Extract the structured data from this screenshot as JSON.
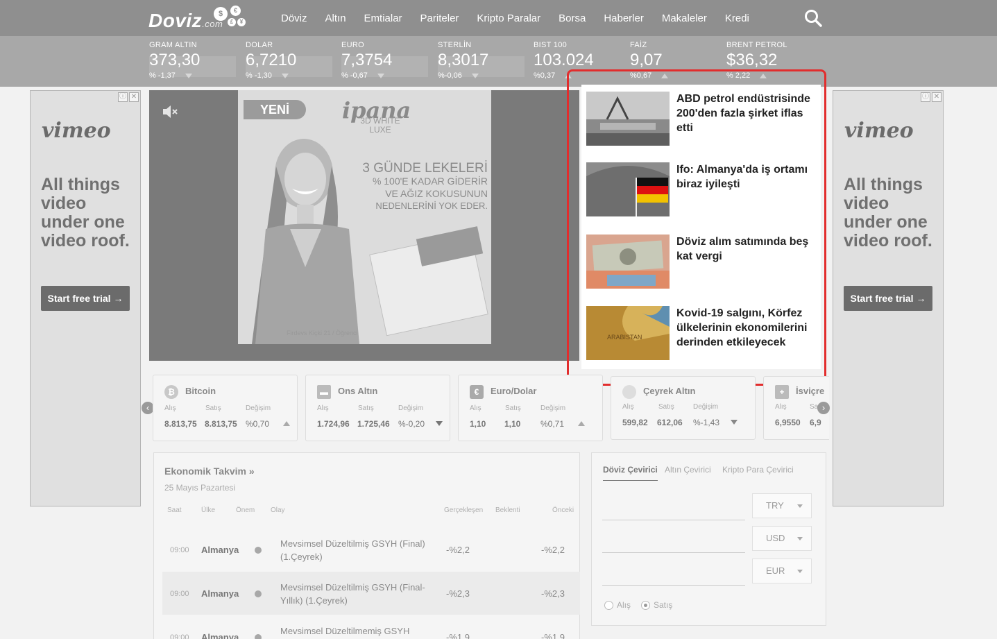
{
  "logo": {
    "text": "Doviz",
    "suffix": ".com",
    "coins": [
      "$",
      "€",
      "£",
      "¥"
    ]
  },
  "nav": [
    "Döviz",
    "Altın",
    "Emtialar",
    "Pariteler",
    "Kripto Paralar",
    "Borsa",
    "Haberler",
    "Makaleler",
    "Kredi"
  ],
  "ticker": [
    {
      "name": "GRAM ALTIN",
      "value": "373,30",
      "change": "% -1,37",
      "dir": "down"
    },
    {
      "name": "DOLAR",
      "value": "6,7210",
      "change": "% -1,30",
      "dir": "down"
    },
    {
      "name": "EURO",
      "value": "7,3754",
      "change": "% -0,67",
      "dir": "down"
    },
    {
      "name": "STERLİN",
      "value": "8,3017",
      "change": "%-0,06",
      "dir": "down"
    },
    {
      "name": "BIST 100",
      "value": "103.024",
      "change": "%0,37",
      "dir": "up"
    },
    {
      "name": "FAİZ",
      "value": "9,07",
      "change": "%0,67",
      "dir": "up"
    },
    {
      "name": "BRENT PETROL",
      "value": "$36,32",
      "change": "% 2,22",
      "dir": "up"
    }
  ],
  "side_ad": {
    "brand": "vimeo",
    "tagline": "All things video under one video roof.",
    "cta": "Start free trial →",
    "info": "ⓘ",
    "close": "✕"
  },
  "video_ad": {
    "badge": "YENİ",
    "logo": "ipana",
    "sub": "3D WHITE LUXE",
    "line1": "3 GÜNDE LEKELERİ",
    "line2": "% 100'E KADAR GİDERİR",
    "line3": "VE AĞIZ KOKUSUNUN",
    "line4": "NEDENLERİNİ YOK EDER.",
    "footer": "Firdevs Kiçki  21 / Öğrenci"
  },
  "news": [
    {
      "title": "ABD petrol endüstrisinde 200'den fazla şirket iflas etti",
      "thumb": "oil-field"
    },
    {
      "title": "Ifo: Almanya'da iş ortamı biraz iyileşti",
      "thumb": "german-flag"
    },
    {
      "title": "Döviz alım satımında beş kat vergi",
      "thumb": "banknotes"
    },
    {
      "title": "Kovid-19 salgını, Körfez ülkelerinin ekonomilerini derinden etkileyecek",
      "thumb": "map"
    }
  ],
  "cards": [
    {
      "name": "Bitcoin",
      "icon": "₿",
      "buy": "8.813,75",
      "sell": "8.813,75",
      "change": "%0,70",
      "dir": "up"
    },
    {
      "name": "Ons Altın",
      "icon": "▬",
      "buy": "1.724,96",
      "sell": "1.725,46",
      "change": "%-0,20",
      "dir": "down"
    },
    {
      "name": "Euro/Dolar",
      "icon": "€",
      "buy": "1,10",
      "sell": "1,10",
      "change": "%0,71",
      "dir": "up"
    },
    {
      "name": "Çeyrek Altın",
      "icon": "",
      "buy": "599,82",
      "sell": "612,06",
      "change": "%-1,43",
      "dir": "down"
    },
    {
      "name": "İsviçre",
      "icon": "+",
      "buy": "6,9550",
      "sell": "6,9",
      "change": "",
      "dir": ""
    }
  ],
  "card_headers": {
    "buy": "Alış",
    "sell": "Satış",
    "change": "Değişim"
  },
  "calendar": {
    "title": "Ekonomik Takvim »",
    "date": "25 Mayıs Pazartesi",
    "headers": {
      "time": "Saat",
      "country": "Ülke",
      "importance": "Önem",
      "event": "Olay",
      "actual": "Gerçekleşen",
      "expected": "Beklenti",
      "previous": "Önceki"
    },
    "rows": [
      {
        "time": "09:00",
        "country": "Almanya",
        "event": "Mevsimsel Düzeltilmiş GSYH (Final) (1.Çeyrek)",
        "actual": "-%2,2",
        "previous": "-%2,2"
      },
      {
        "time": "09:00",
        "country": "Almanya",
        "event": "Mevsimsel Düzeltilmiş GSYH (Final-Yıllık) (1.Çeyrek)",
        "actual": "-%2,3",
        "previous": "-%2,3"
      },
      {
        "time": "09:00",
        "country": "Almanya",
        "event": "Mevsimsel Düzeltilmemiş GSYH (Final-",
        "actual": "-%1,9",
        "previous": "-%1,9"
      }
    ]
  },
  "converter": {
    "tabs": [
      "Döviz Çevirici",
      "Altın Çevirici",
      "Kripto Para Çevirici"
    ],
    "currencies": [
      "TRY",
      "USD",
      "EUR"
    ],
    "radio": [
      "Alış",
      "Satış"
    ]
  }
}
